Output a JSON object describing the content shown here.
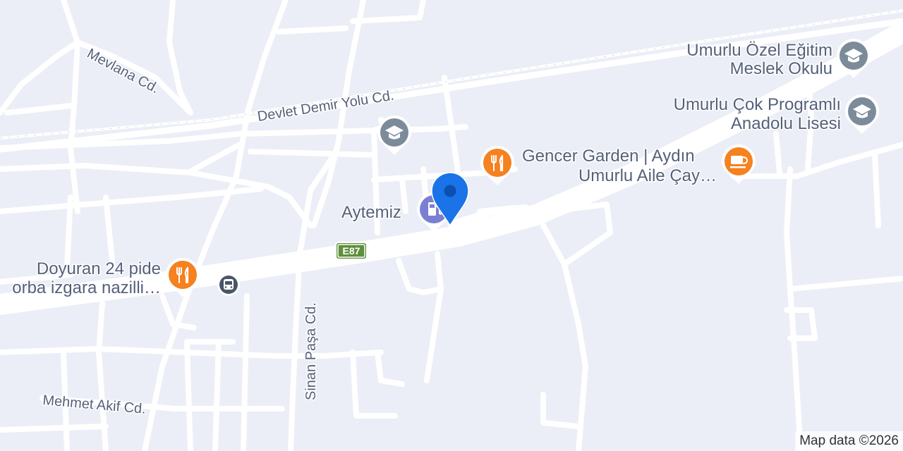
{
  "map": {
    "streets": {
      "mevlana": "Mevlana Cd.",
      "devlet_demir_yolu": "Devlet Demir Yolu Cd.",
      "sinan_pasa": "Sinan Paşa Cd.",
      "mehmet_akif": "Mehmet Akif Cd."
    },
    "highway_shield": "E87",
    "pois": {
      "school_ozel": {
        "line1": "Umurlu Özel Eğitim",
        "line2": "Meslek Okulu",
        "icon": "graduation-cap-icon"
      },
      "school_anadolu": {
        "line1": "Umurlu Çok Programlı",
        "line2": "Anadolu Lisesi",
        "icon": "graduation-cap-icon"
      },
      "school_unnamed": {
        "icon": "graduation-cap-icon"
      },
      "gencer_garden": {
        "line1": "Gencer Garden | Aydın",
        "icon": "restaurant-icon",
        "color": "#f5811f"
      },
      "umurlu_aile_cay": {
        "line1": "Umurlu Aile Çay…",
        "icon": "cafe-icon",
        "color": "#f5811f"
      },
      "aytemiz": {
        "line1": "Aytemiz",
        "icon": "gas-station-icon",
        "color": "#7b7fd4"
      },
      "doyuran": {
        "line1": "Doyuran 24 pide",
        "line2": "orba izgara nazilli…",
        "icon": "restaurant-icon",
        "color": "#f5811f"
      },
      "bus_stop": {
        "icon": "bus-icon"
      }
    },
    "location_pin": {
      "icon": "location-pin-icon",
      "color": "#1a73e8"
    },
    "colors": {
      "background": "#ebeef6",
      "road": "#ffffff",
      "label": "#55607a",
      "school": "#7b8b99",
      "shield": "#5e8f3c"
    }
  },
  "attribution": "Map data ©2026"
}
